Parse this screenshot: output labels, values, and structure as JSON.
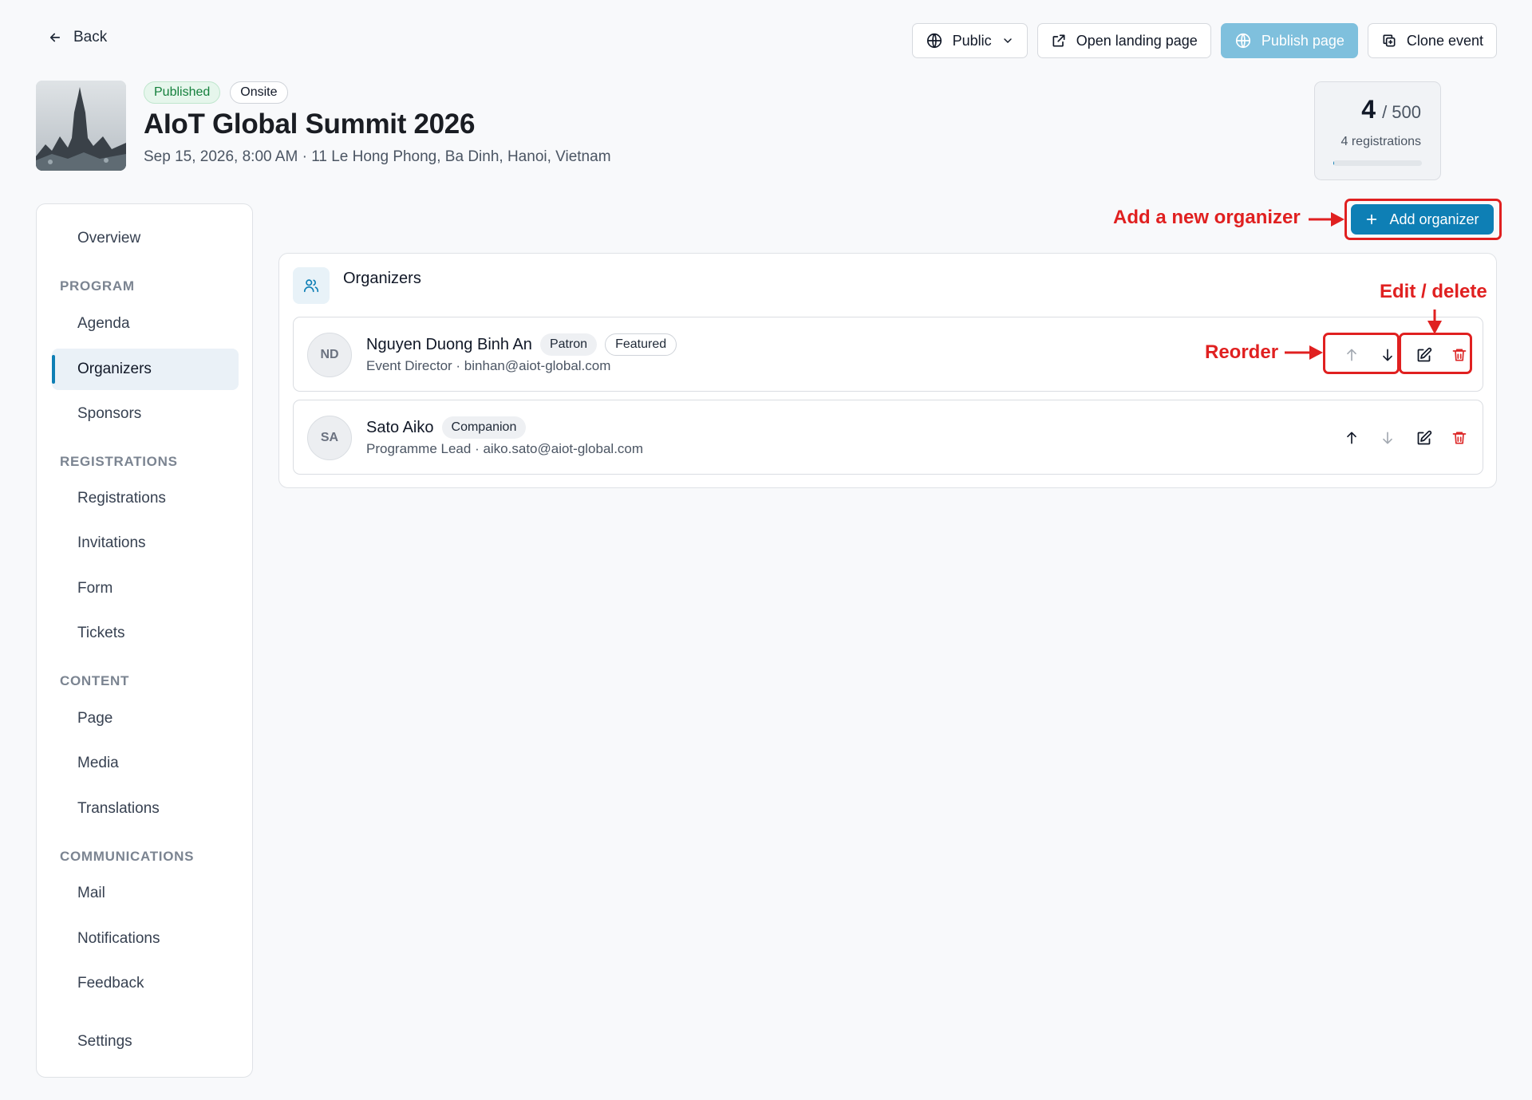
{
  "topbar": {
    "back_label": "Back",
    "visibility_label": "Public",
    "open_landing_label": "Open landing page",
    "publish_label": "Publish page",
    "clone_label": "Clone event"
  },
  "event": {
    "status_badge": "Published",
    "mode_badge": "Onsite",
    "title": "AIoT Global Summit 2026",
    "subtitle": "Sep 15, 2026, 8:00 AM · 11 Le Hong Phong, Ba Dinh, Hanoi, Vietnam"
  },
  "capacity": {
    "count": "4",
    "max": "/ 500",
    "label": "4 registrations",
    "fill_fraction": 0.008
  },
  "sidebar": {
    "overview": "Overview",
    "program_header": "PROGRAM",
    "agenda": "Agenda",
    "organizers": "Organizers",
    "sponsors": "Sponsors",
    "registrations_header": "REGISTRATIONS",
    "registrations": "Registrations",
    "invitations": "Invitations",
    "form": "Form",
    "tickets": "Tickets",
    "content_header": "CONTENT",
    "page": "Page",
    "media": "Media",
    "translations": "Translations",
    "communications_header": "COMMUNICATIONS",
    "mail": "Mail",
    "notifications": "Notifications",
    "feedback": "Feedback",
    "settings": "Settings"
  },
  "main": {
    "add_button_label": "Add organizer",
    "panel_title": "Organizers",
    "organizers": [
      {
        "initials": "ND",
        "name": "Nguyen Duong Binh An",
        "tags": [
          "Patron",
          "Featured"
        ],
        "role_email": "Event Director · binhan@aiot-global.com"
      },
      {
        "initials": "SA",
        "name": "Sato Aiko",
        "tags": [
          "Companion"
        ],
        "role_email": "Programme Lead · aiko.sato@aiot-global.com"
      }
    ]
  },
  "annotations": {
    "add": "Add a new organizer",
    "edit_delete": "Edit / delete",
    "reorder": "Reorder"
  },
  "colors": {
    "accent": "#0e7fb5",
    "annotation": "#e02020",
    "delete": "#dc2626",
    "published_green": "#15803d"
  }
}
